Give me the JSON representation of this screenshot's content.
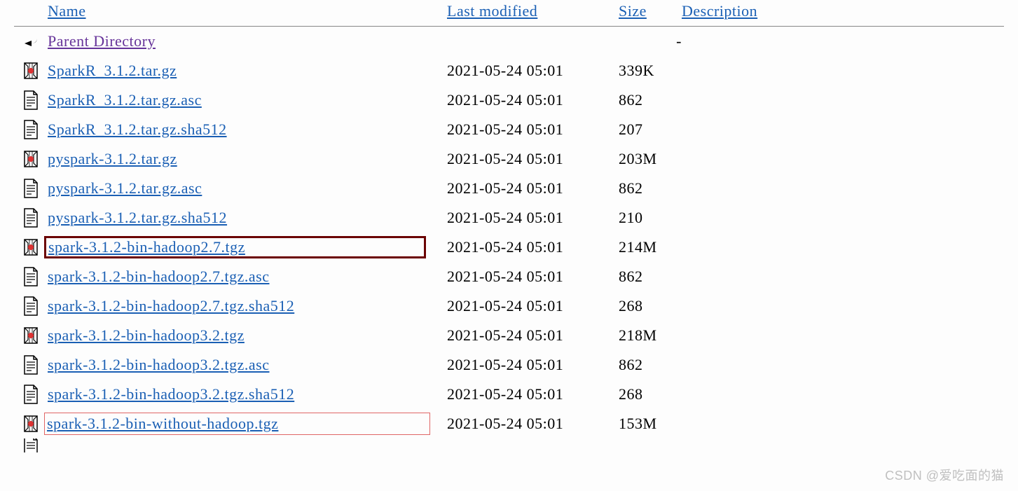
{
  "header": {
    "name": "Name",
    "last_modified": "Last modified",
    "size": "Size",
    "description": "Description"
  },
  "parent": {
    "label": "Parent Directory",
    "size": "-"
  },
  "rows": [
    {
      "icon": "archive",
      "name": "SparkR_3.1.2.tar.gz",
      "modified": "2021-05-24 05:01",
      "size": "339K",
      "highlight": ""
    },
    {
      "icon": "text",
      "name": "SparkR_3.1.2.tar.gz.asc",
      "modified": "2021-05-24 05:01",
      "size": "862",
      "highlight": ""
    },
    {
      "icon": "text",
      "name": "SparkR_3.1.2.tar.gz.sha512",
      "modified": "2021-05-24 05:01",
      "size": "207",
      "highlight": ""
    },
    {
      "icon": "archive",
      "name": "pyspark-3.1.2.tar.gz",
      "modified": "2021-05-24 05:01",
      "size": "203M",
      "highlight": ""
    },
    {
      "icon": "text",
      "name": "pyspark-3.1.2.tar.gz.asc",
      "modified": "2021-05-24 05:01",
      "size": "862",
      "highlight": ""
    },
    {
      "icon": "text",
      "name": "pyspark-3.1.2.tar.gz.sha512",
      "modified": "2021-05-24 05:01",
      "size": "210",
      "highlight": ""
    },
    {
      "icon": "archive",
      "name": "spark-3.1.2-bin-hadoop2.7.tgz",
      "modified": "2021-05-24 05:01",
      "size": "214M",
      "highlight": "darkred"
    },
    {
      "icon": "text",
      "name": "spark-3.1.2-bin-hadoop2.7.tgz.asc",
      "modified": "2021-05-24 05:01",
      "size": "862",
      "highlight": ""
    },
    {
      "icon": "text",
      "name": "spark-3.1.2-bin-hadoop2.7.tgz.sha512",
      "modified": "2021-05-24 05:01",
      "size": "268",
      "highlight": ""
    },
    {
      "icon": "archive",
      "name": "spark-3.1.2-bin-hadoop3.2.tgz",
      "modified": "2021-05-24 05:01",
      "size": "218M",
      "highlight": ""
    },
    {
      "icon": "text",
      "name": "spark-3.1.2-bin-hadoop3.2.tgz.asc",
      "modified": "2021-05-24 05:01",
      "size": "862",
      "highlight": ""
    },
    {
      "icon": "text",
      "name": "spark-3.1.2-bin-hadoop3.2.tgz.sha512",
      "modified": "2021-05-24 05:01",
      "size": "268",
      "highlight": ""
    },
    {
      "icon": "archive",
      "name": "spark-3.1.2-bin-without-hadoop.tgz",
      "modified": "2021-05-24 05:01",
      "size": "153M",
      "highlight": "lightred"
    }
  ],
  "watermark": "CSDN @爱吃面的猫"
}
